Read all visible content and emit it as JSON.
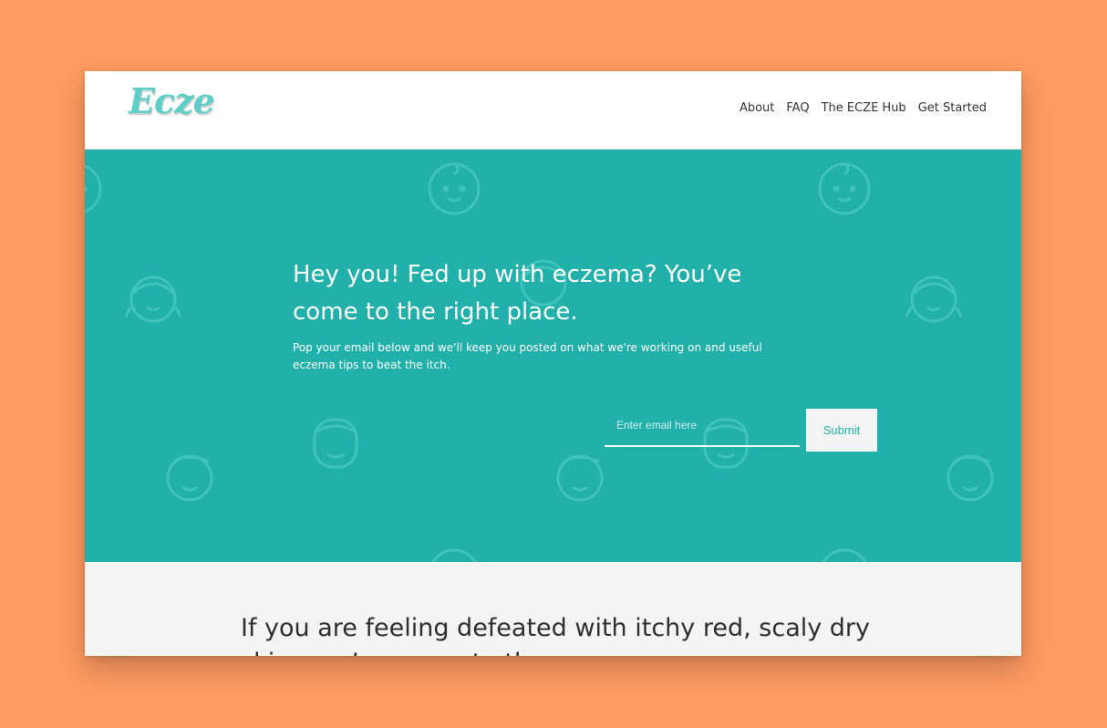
{
  "header": {
    "logo_text": "Ecze",
    "nav": [
      "About",
      "FAQ",
      "The ECZE Hub",
      "Get Started"
    ]
  },
  "hero": {
    "title": "Hey you! Fed up with eczema? You’ve come to the right place.",
    "subtitle": "Pop your email below and we'll keep you posted on what we're working on and useful eczema tips to beat the itch.",
    "email_placeholder": "Enter email here",
    "submit_label": "Submit"
  },
  "section": {
    "title": "If you are feeling defeated with itchy red, scaly dry skin, you’ve come to the"
  },
  "colors": {
    "background": "#FF9B62",
    "hero": "#21B1AA",
    "logo": "#5ECFC8",
    "section": "#F4F4F4"
  }
}
